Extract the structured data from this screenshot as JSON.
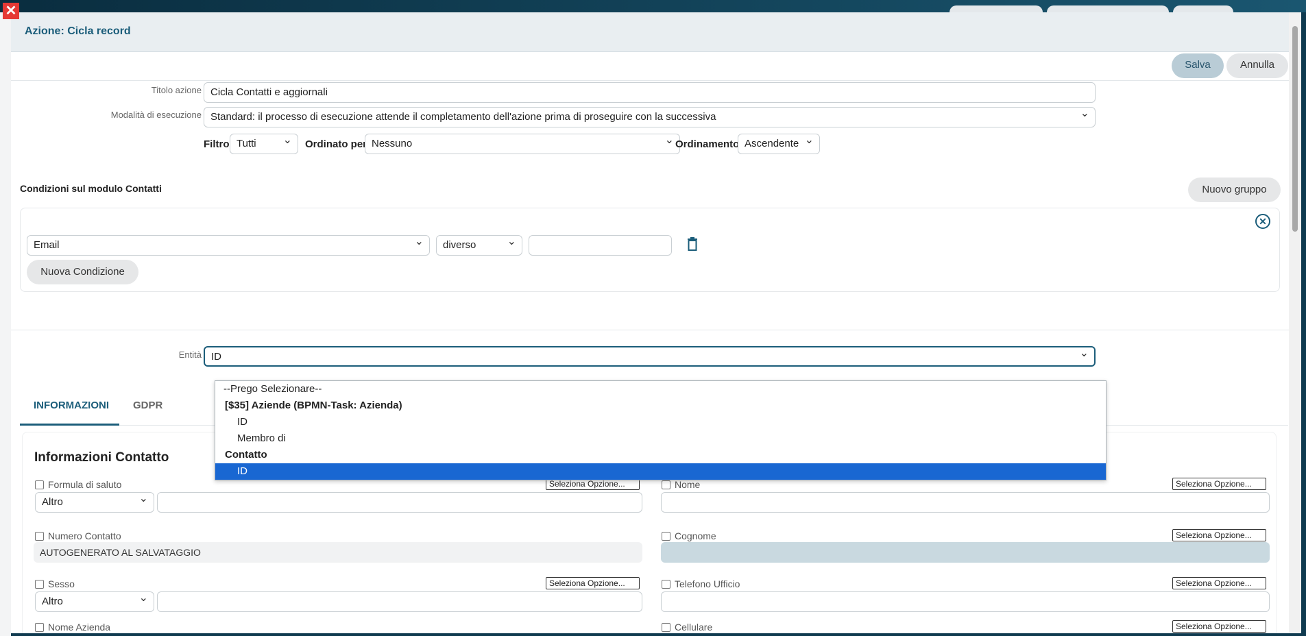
{
  "modal": {
    "title": "Azione: Cicla record"
  },
  "toolbar": {
    "save_label": "Salva",
    "cancel_label": "Annulla"
  },
  "form": {
    "title_label": "Titolo azione",
    "title_value": "Cicla Contatti e aggiornali",
    "mode_label": "Modalità di esecuzione",
    "mode_value": "Standard: il processo di esecuzione attende il completamento dell'azione prima di proseguire con la successiva",
    "filter_label": "Filtro",
    "filter_value": "Tutti",
    "order_by_label": "Ordinato per",
    "order_by_value": "Nessuno",
    "ordering_label": "Ordinamento",
    "ordering_value": "Ascendente"
  },
  "conditions": {
    "title": "Condizioni sul modulo Contatti",
    "new_group_label": "Nuovo gruppo",
    "field_value": "Email",
    "operator_value": "diverso",
    "value_placeholder": "",
    "new_condition_label": "Nuova Condizione"
  },
  "entity": {
    "label": "Entità",
    "value": "ID",
    "options": [
      {
        "label": "--Prego Selezionare--",
        "kind": "option"
      },
      {
        "label": "[$35] Aziende (BPMN-Task: Azienda)",
        "kind": "group"
      },
      {
        "label": "ID",
        "kind": "child"
      },
      {
        "label": "Membro di",
        "kind": "child"
      },
      {
        "label": "Contatto",
        "kind": "group"
      },
      {
        "label": "ID",
        "kind": "child-selected"
      }
    ]
  },
  "tabs": [
    {
      "label": "INFORMAZIONI",
      "active": true
    },
    {
      "label": "GDPR",
      "active": false
    }
  ],
  "panel": {
    "title": "Informazioni Contatto",
    "select_option_label": "Seleziona Opzione...",
    "fields": {
      "salutation": "Formula di saluto",
      "first_name": "Nome",
      "contact_number": "Numero Contatto",
      "last_name": "Cognome",
      "gender": "Sesso",
      "office_phone": "Telefono Ufficio",
      "company_name": "Nome Azienda",
      "mobile": "Cellulare"
    },
    "salutation_select": "Altro",
    "gender_select": "Altro",
    "autogenerated_text": "AUTOGENERATO AL SALVATAGGIO"
  },
  "colors": {
    "accent": "#1b5d7a",
    "save_bg": "#b9ccd6",
    "selected_option": "#1967d2",
    "close_red": "#e53935"
  }
}
